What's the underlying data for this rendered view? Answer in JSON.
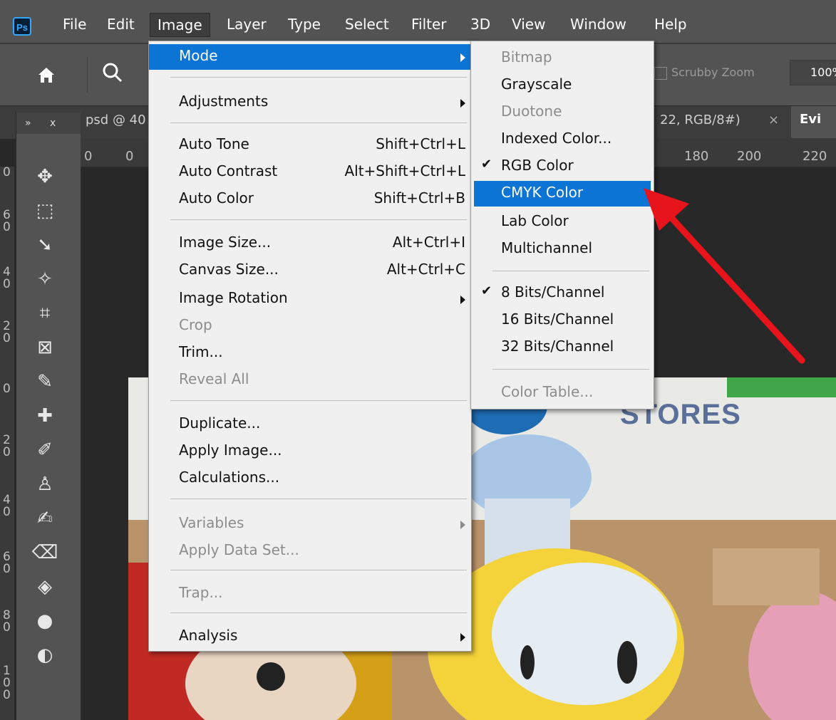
{
  "app": {
    "logo_text": "Ps"
  },
  "menubar": {
    "items": [
      "File",
      "Edit",
      "Image",
      "Layer",
      "Type",
      "Select",
      "Filter",
      "3D",
      "View",
      "Window",
      "Help"
    ]
  },
  "options_bar": {
    "scrubby_zoom": "Scrubby Zoom",
    "zoom_value": "100%"
  },
  "tabs": {
    "tab1": "psd @ 40",
    "tab2": "22, RGB/8#)",
    "tab2_close": "×",
    "tab3": "Evi"
  },
  "toolbar_header": {
    "expand": "»",
    "close": "x"
  },
  "ruler": {
    "h": [
      "0",
      "0",
      "180",
      "200",
      "220"
    ],
    "v": [
      "0",
      "6\n0",
      "4\n0",
      "2\n0",
      "0",
      "2\n0",
      "4\n0",
      "6\n0",
      "8\n0",
      "1\n0\n0"
    ]
  },
  "image_menu": {
    "mode": "Mode",
    "adjustments": "Adjustments",
    "auto_tone": "Auto Tone",
    "auto_tone_sc": "Shift+Ctrl+L",
    "auto_contrast": "Auto Contrast",
    "auto_contrast_sc": "Alt+Shift+Ctrl+L",
    "auto_color": "Auto Color",
    "auto_color_sc": "Shift+Ctrl+B",
    "image_size": "Image Size...",
    "image_size_sc": "Alt+Ctrl+I",
    "canvas_size": "Canvas Size...",
    "canvas_size_sc": "Alt+Ctrl+C",
    "image_rotation": "Image Rotation",
    "crop": "Crop",
    "trim": "Trim...",
    "reveal_all": "Reveal All",
    "duplicate": "Duplicate...",
    "apply_image": "Apply Image...",
    "calculations": "Calculations...",
    "variables": "Variables",
    "apply_data_set": "Apply Data Set...",
    "trap": "Trap...",
    "analysis": "Analysis"
  },
  "mode_menu": {
    "bitmap": "Bitmap",
    "grayscale": "Grayscale",
    "duotone": "Duotone",
    "indexed_color": "Indexed Color...",
    "rgb_color": "RGB Color",
    "cmyk_color": "CMYK Color",
    "lab_color": "Lab Color",
    "multichannel": "Multichannel",
    "bits8": "8 Bits/Channel",
    "bits16": "16 Bits/Channel",
    "bits32": "32 Bits/Channel",
    "color_table": "Color Table...",
    "check": "✔"
  },
  "photo": {
    "sign_text": "STORES"
  },
  "colors": {
    "highlight": "#0b74d5",
    "menu_bg": "#f0f0f0",
    "annotation_arrow": "#e8141b"
  }
}
